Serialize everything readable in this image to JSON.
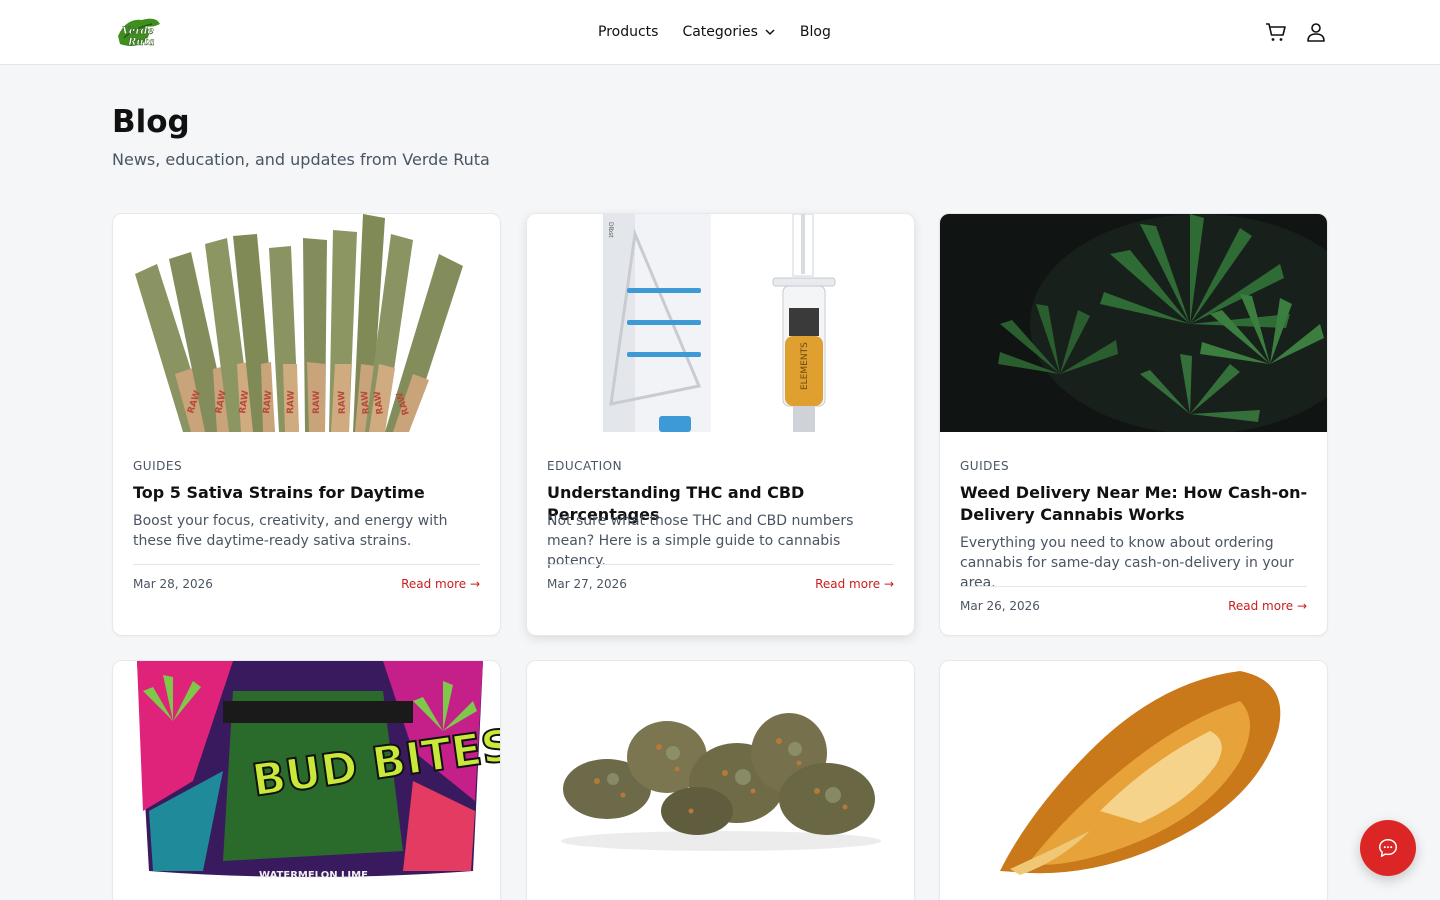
{
  "brand": {
    "logo_text": "Verde Ruta",
    "accent": "#dc2626",
    "link_color": "#c81e1e"
  },
  "header": {
    "nav": [
      {
        "label": "Products"
      },
      {
        "label": "Categories"
      },
      {
        "label": "Blog"
      }
    ],
    "icons": [
      "cart-icon",
      "user-icon"
    ]
  },
  "page": {
    "title": "Blog",
    "subtitle": "News, education, and updates from Verde Ruta"
  },
  "posts": [
    {
      "category": "GUIDES",
      "title": "Top 5 Sativa Strains for Daytime",
      "excerpt": "Boost your focus, creativity, and energy with these five daytime-ready sativa strains.",
      "date": "Mar 28, 2026",
      "read_more": "Read more →",
      "image": "pre-rolls"
    },
    {
      "category": "EDUCATION",
      "title": "Understanding THC and CBD Percentages",
      "excerpt": "Not sure what those THC and CBD numbers mean? Here is a simple guide to cannabis potency.",
      "date": "Mar 27, 2026",
      "read_more": "Read more →",
      "image": "oil-syringe"
    },
    {
      "category": "GUIDES",
      "title": "Weed Delivery Near Me: How Cash-on-Delivery Cannabis Works",
      "excerpt": "Everything you need to know about ordering cannabis for same-day cash-on-delivery in your area.",
      "date": "Mar 26, 2026",
      "read_more": "Read more →",
      "image": "cannabis-leaves"
    },
    {
      "image": "bud-bites-bag",
      "image_text": "BUD BITES",
      "image_caption": "WATERMELON LIME"
    },
    {
      "image": "cannabis-buds"
    },
    {
      "image": "concentrate"
    }
  ],
  "chat": {
    "icon": "chat-icon"
  }
}
